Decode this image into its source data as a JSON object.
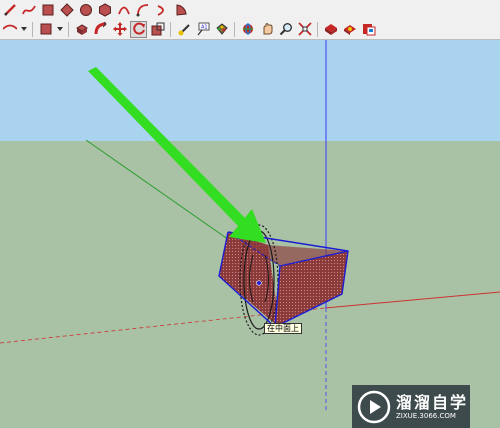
{
  "viewport": {
    "cursor_tooltip": "在中面上",
    "colors": {
      "sky": "#a9d3ee",
      "ground": "#a9c1a5",
      "face_selected": "#8b3a3a",
      "selection_edge": "#1c1cd4",
      "annotation_arrow": "#33dd22",
      "axis_blue": "#3a3aff",
      "axis_red": "#cc3333",
      "axis_green": "#2d9e2d"
    }
  },
  "watermark": {
    "title": "溜溜自学",
    "url": "ZIXUE.3066.COM"
  },
  "toolbar_row1": [
    {
      "name": "pencil-tool-icon"
    },
    {
      "name": "freehand-tool-icon"
    },
    {
      "name": "rectangle-tool-icon"
    },
    {
      "name": "rotated-rectangle-tool-icon"
    },
    {
      "name": "circle-tool-icon"
    },
    {
      "name": "polygon-tool-icon"
    },
    {
      "name": "arc-tool-icon"
    },
    {
      "name": "two-point-arc-tool-icon"
    },
    {
      "name": "three-point-arc-tool-icon"
    },
    {
      "name": "pie-tool-icon"
    }
  ],
  "toolbar_row2": [
    {
      "name": "eraser-dropdown-icon"
    },
    {
      "name": "paint-bucket-dropdown-icon"
    },
    {
      "name": "push-pull-tool-icon"
    },
    {
      "name": "follow-me-tool-icon"
    },
    {
      "name": "move-tool-icon"
    },
    {
      "name": "rotate-tool-icon",
      "active": true
    },
    {
      "name": "scale-tool-icon"
    },
    {
      "name": "tape-measure-tool-icon"
    },
    {
      "name": "text-tool-icon"
    },
    {
      "name": "paint-bucket-tool-icon"
    },
    {
      "name": "orbit-tool-icon"
    },
    {
      "name": "pan-tool-icon"
    },
    {
      "name": "zoom-tool-icon"
    },
    {
      "name": "zoom-extents-tool-icon"
    },
    {
      "name": "3d-warehouse-icon"
    },
    {
      "name": "extension-warehouse-icon"
    },
    {
      "name": "layout-send-icon"
    }
  ]
}
